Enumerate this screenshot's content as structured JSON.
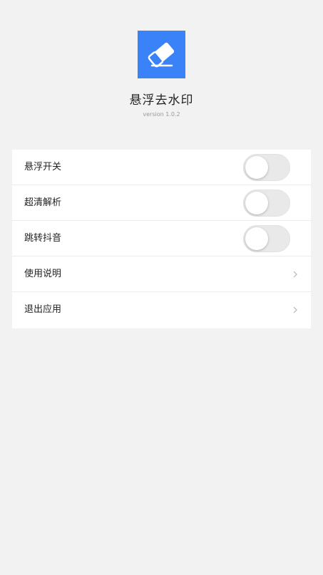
{
  "app": {
    "title": "悬浮去水印",
    "version": "version 1.0.2",
    "icon": "eraser-icon",
    "accent_color": "#3a82f7"
  },
  "settings": {
    "items": [
      {
        "label": "悬浮开关",
        "type": "toggle",
        "checked": false
      },
      {
        "label": "超清解析",
        "type": "toggle",
        "checked": false
      },
      {
        "label": "跳转抖音",
        "type": "toggle",
        "checked": false
      },
      {
        "label": "使用说明",
        "type": "link",
        "icon": "chevron-right-icon"
      },
      {
        "label": "退出应用",
        "type": "link",
        "icon": "chevron-right-icon"
      }
    ]
  }
}
